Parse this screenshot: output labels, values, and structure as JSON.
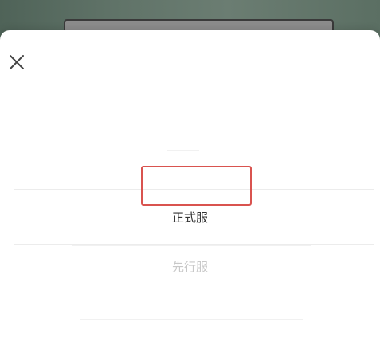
{
  "background": {
    "color_left": "#4f6358",
    "color_right": "#5b6f63"
  },
  "sheet": {
    "close_icon": "close-icon",
    "options": [
      {
        "label": "正式服",
        "selected": true
      },
      {
        "label": "先行服",
        "selected": false
      }
    ],
    "highlight_color": "#d9534f"
  }
}
